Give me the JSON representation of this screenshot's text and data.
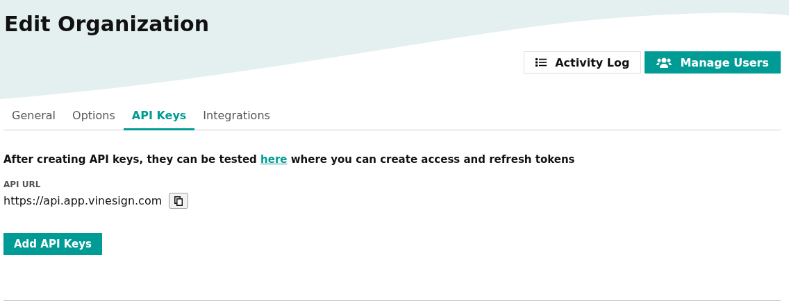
{
  "page": {
    "title": "Edit Organization"
  },
  "actions": [
    {
      "kind": "log",
      "label": "Activity Log"
    },
    {
      "kind": "users",
      "label": "Manage Users"
    }
  ],
  "tabs": [
    {
      "label": "General",
      "selected": false
    },
    {
      "label": "Options",
      "selected": false
    },
    {
      "label": "API Keys",
      "selected": true
    },
    {
      "label": "Integrations",
      "selected": false
    }
  ],
  "api_keys": {
    "intro_before": "After creating API keys, they can be tested",
    "intro_link": "here",
    "intro_after": "where you can create access and refresh tokens",
    "url_label": "API URL",
    "url": "https://api.app.vinesign.com",
    "add_button": "Add API Keys"
  }
}
